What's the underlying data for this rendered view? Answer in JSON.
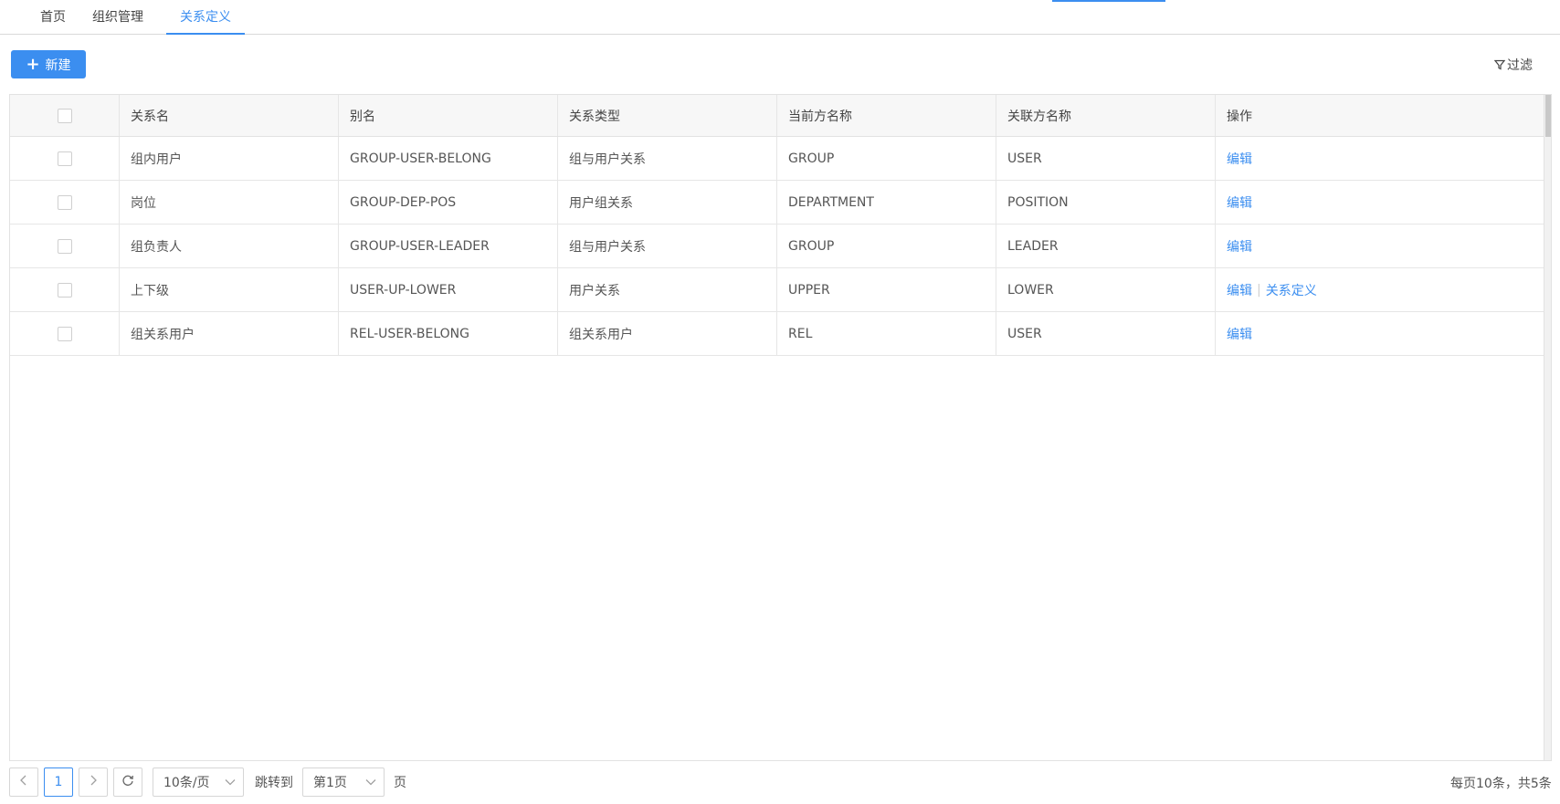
{
  "tabs": {
    "home": "首页",
    "org": "组织管理",
    "relation": "关系定义"
  },
  "toolbar": {
    "new_label": "新建",
    "filter_label": "过滤"
  },
  "table": {
    "headers": {
      "name": "关系名",
      "alias": "别名",
      "type": "关系类型",
      "current": "当前方名称",
      "related": "关联方名称",
      "ops": "操作"
    },
    "rows": [
      {
        "name": "组内用户",
        "alias": "GROUP-USER-BELONG",
        "type": "组与用户关系",
        "current": "GROUP",
        "related": "USER",
        "edit": "编辑"
      },
      {
        "name": "岗位",
        "alias": "GROUP-DEP-POS",
        "type": "用户组关系",
        "current": "DEPARTMENT",
        "related": "POSITION",
        "edit": "编辑"
      },
      {
        "name": "组负责人",
        "alias": "GROUP-USER-LEADER",
        "type": "组与用户关系",
        "current": "GROUP",
        "related": "LEADER",
        "edit": "编辑"
      },
      {
        "name": "上下级",
        "alias": "USER-UP-LOWER",
        "type": "用户关系",
        "current": "UPPER",
        "related": "LOWER",
        "edit": "编辑",
        "extra": "关系定义"
      },
      {
        "name": "组关系用户",
        "alias": "REL-USER-BELONG",
        "type": "组关系用户",
        "current": "REL",
        "related": "USER",
        "edit": "编辑"
      }
    ]
  },
  "pagination": {
    "current_page": "1",
    "page_size": "10条/页",
    "jump_label": "跳转到",
    "jump_value": "第1页",
    "page_suffix": "页",
    "summary": "每页10条，共5条"
  },
  "icons": {
    "add": "plus-icon",
    "filter": "funnel-icon",
    "prev": "chevron-left-icon",
    "next": "chevron-right-icon",
    "refresh": "refresh-icon",
    "dropdown": "chevron-down-icon"
  },
  "colors": {
    "accent": "#3b8ef0",
    "header_bg": "#f7f7f7",
    "border": "#e2e2e2"
  }
}
